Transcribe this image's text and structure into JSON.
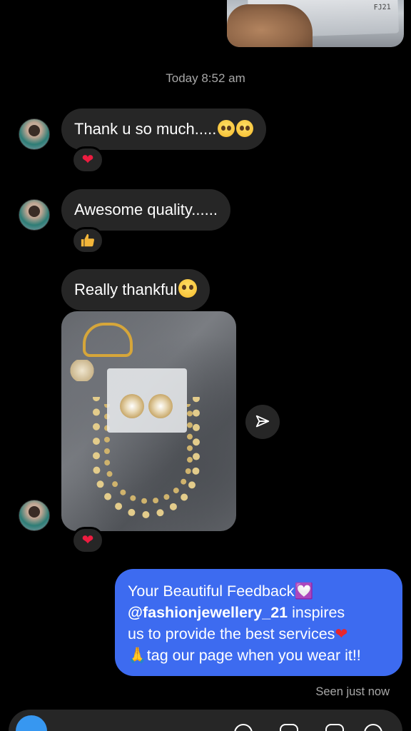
{
  "timestamp": "Today 8:52 am",
  "messages": {
    "msg1": {
      "text": "Thank u so much.....",
      "reaction": "heart"
    },
    "msg2": {
      "text": "Awesome quality......",
      "reaction": "thumbs-up"
    },
    "msg3": {
      "text": "Really thankful"
    },
    "msg4_photo": {
      "reaction": "heart"
    }
  },
  "reply": {
    "line1": "Your Beautiful Feedback",
    "mention": "@fashionjewellery_21",
    "line2": " inspires",
    "line3": "us to provide the best services",
    "line4": "tag our page when you wear it!!"
  },
  "status": {
    "seen": "Seen just now"
  },
  "top_photo": {
    "fragment": "FJ21"
  },
  "colors": {
    "background": "#000000",
    "incoming_bubble": "#262626",
    "outgoing_bubble": "#3d6bf0",
    "meta_text": "#a8a8a8",
    "heart": "#ed1c40",
    "camera": "#3797f0"
  },
  "icons": {
    "share": "paper-plane-icon",
    "heart": "heart-icon",
    "thumbs": "thumbs-up-icon",
    "camera": "camera-icon"
  }
}
